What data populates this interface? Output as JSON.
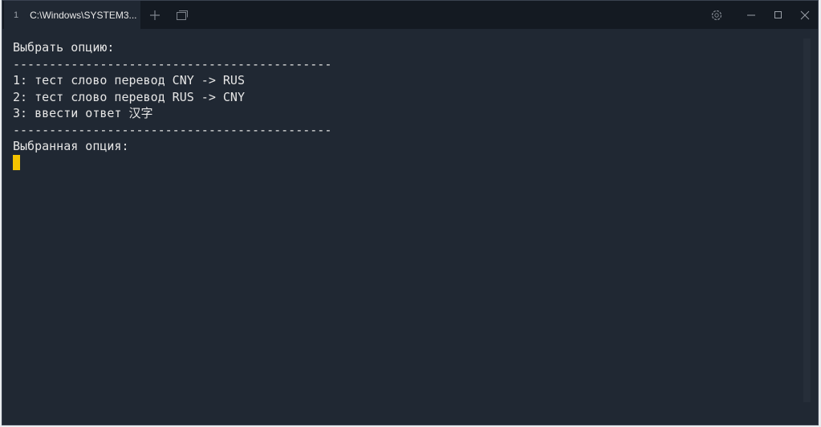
{
  "tab": {
    "number": "1",
    "title": "C:\\Windows\\SYSTEM3..."
  },
  "icons": {
    "new_tab": "plus-icon",
    "dropdown": "tabs-icon",
    "settings": "gear-icon",
    "minimize": "minimize-icon",
    "maximize": "maximize-icon",
    "close": "close-icon"
  },
  "terminal": {
    "lines": [
      "Выбрать опцию:",
      "--------------------------------------------",
      "1: тест слово перевод CNY -> RUS",
      "2: тест слово перевод RUS -> CNY",
      "3: ввести ответ 汉字",
      "--------------------------------------------",
      "Выбранная опция:"
    ]
  },
  "colors": {
    "cursor": "#f5c400",
    "background": "#202833"
  }
}
